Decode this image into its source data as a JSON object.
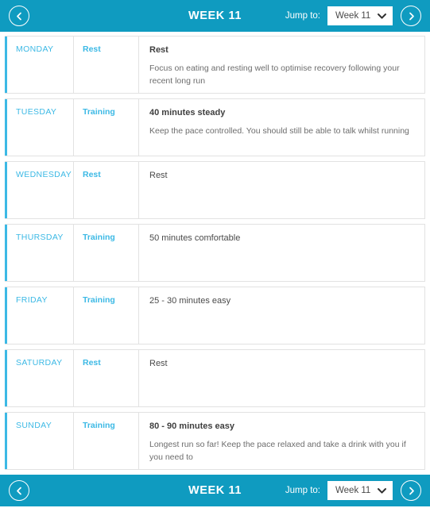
{
  "header": {
    "title": "WEEK 11",
    "prev_label": "Previous week",
    "next_label": "Next week",
    "jump_label": "Jump to:",
    "jump_value": "Week 11",
    "jump_options": [
      "Week 11"
    ]
  },
  "footer": {
    "title": "WEEK 11",
    "prev_label": "Previous week",
    "next_label": "Next week",
    "jump_label": "Jump to:",
    "jump_value": "Week 11",
    "jump_options": [
      "Week 11"
    ]
  },
  "colors": {
    "bar_teal": "#0f9bc0",
    "accent_blue": "#3cb9e5",
    "border_grey": "#e2e2e2",
    "body_text": "#6d6d6d",
    "heading_text": "#3f3f3f"
  },
  "days": [
    {
      "day": "MONDAY",
      "type": "Rest",
      "title": "Rest",
      "title_bold": true,
      "description": "Focus on eating and resting well to optimise recovery following your recent long run"
    },
    {
      "day": "TUESDAY",
      "type": "Training",
      "title": "40 minutes steady",
      "title_bold": true,
      "description": "Keep the pace controlled. You should still be able to talk whilst running"
    },
    {
      "day": "WEDNESDAY",
      "type": "Rest",
      "title": "Rest",
      "title_bold": false,
      "description": ""
    },
    {
      "day": "THURSDAY",
      "type": "Training",
      "title": "50 minutes comfortable",
      "title_bold": false,
      "description": ""
    },
    {
      "day": "FRIDAY",
      "type": "Training",
      "title": "25 - 30 minutes easy",
      "title_bold": false,
      "description": ""
    },
    {
      "day": "SATURDAY",
      "type": "Rest",
      "title": "Rest",
      "title_bold": false,
      "description": ""
    },
    {
      "day": "SUNDAY",
      "type": "Training",
      "title": "80 - 90 minutes easy",
      "title_bold": true,
      "description": "Longest run so far! Keep the pace relaxed and take a drink with you if you need to"
    }
  ]
}
